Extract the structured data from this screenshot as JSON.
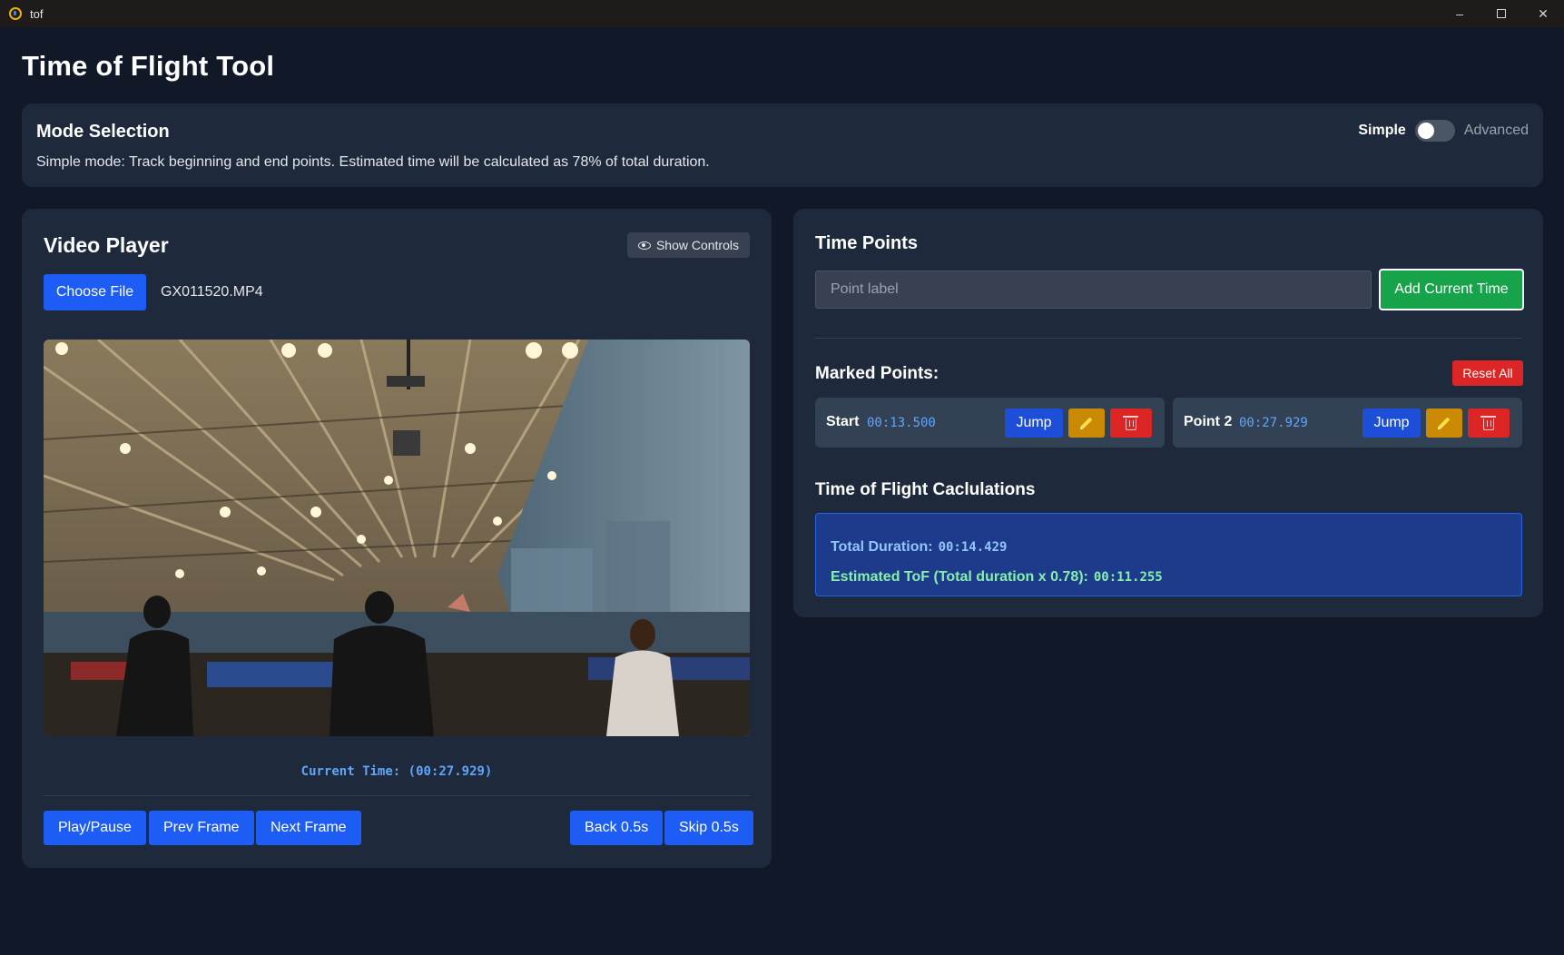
{
  "window": {
    "title": "tof"
  },
  "app_title": "Time of Flight Tool",
  "mode": {
    "title": "Mode Selection",
    "description": "Simple mode: Track beginning and end points. Estimated time will be calculated as 78% of total duration.",
    "simple_label": "Simple",
    "advanced_label": "Advanced",
    "selected": "Simple"
  },
  "video": {
    "title": "Video Player",
    "show_controls_label": "Show Controls",
    "choose_file_label": "Choose File",
    "file_name": "GX011520.MP4",
    "current_time_text": "Current Time: (00:27.929)",
    "buttons": {
      "play_pause": "Play/Pause",
      "prev_frame": "Prev Frame",
      "next_frame": "Next Frame",
      "back": "Back 0.5s",
      "skip": "Skip 0.5s"
    }
  },
  "time_points": {
    "title": "Time Points",
    "input_placeholder": "Point label",
    "add_button": "Add Current Time",
    "marked_title": "Marked Points:",
    "reset_all": "Reset All",
    "points": [
      {
        "label": "Start",
        "time": "00:13.500",
        "jump": "Jump"
      },
      {
        "label": "Point 2",
        "time": "00:27.929",
        "jump": "Jump"
      }
    ]
  },
  "calculations": {
    "title": "Time of Flight Caclulations",
    "total_label": "Total Duration:",
    "total_value": "00:14.429",
    "tof_label": "Estimated ToF (Total duration x 0.78):",
    "tof_value": "00:11.255"
  },
  "colors": {
    "background": "#111827",
    "card": "#1e293b",
    "primary": "#1d5cf5",
    "success": "#16a34a",
    "danger": "#dc2626",
    "warning": "#ca8a04",
    "accent_text": "#60a5fa"
  },
  "icons": [
    "app-icon",
    "minimize-icon",
    "maximize-icon",
    "close-icon",
    "eye-icon",
    "pencil-icon",
    "trash-icon"
  ]
}
